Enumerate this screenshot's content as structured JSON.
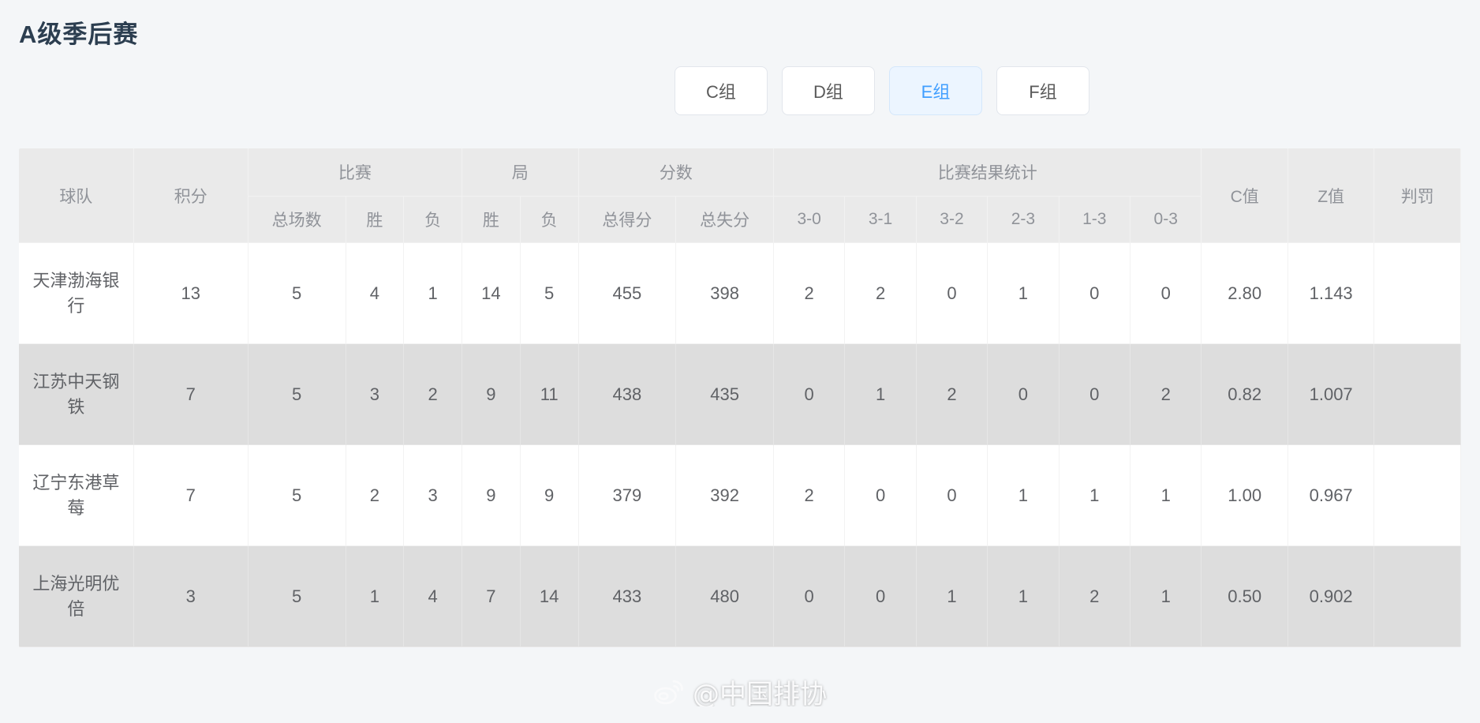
{
  "page": {
    "title": "A级季后赛"
  },
  "tabs": [
    {
      "label": "C组",
      "active": false
    },
    {
      "label": "D组",
      "active": false
    },
    {
      "label": "E组",
      "active": true
    },
    {
      "label": "F组",
      "active": false
    }
  ],
  "table": {
    "group_headers": [
      {
        "label": "球队",
        "rowspan": 2,
        "colspan": 1
      },
      {
        "label": "积分",
        "rowspan": 2,
        "colspan": 1
      },
      {
        "label": "比赛",
        "rowspan": 1,
        "colspan": 3
      },
      {
        "label": "局",
        "rowspan": 1,
        "colspan": 2
      },
      {
        "label": "分数",
        "rowspan": 1,
        "colspan": 2
      },
      {
        "label": "比赛结果统计",
        "rowspan": 1,
        "colspan": 6
      },
      {
        "label": "C值",
        "rowspan": 2,
        "colspan": 1
      },
      {
        "label": "Z值",
        "rowspan": 2,
        "colspan": 1
      },
      {
        "label": "判罚",
        "rowspan": 2,
        "colspan": 1
      }
    ],
    "sub_headers": [
      "总场数",
      "胜",
      "负",
      "胜",
      "负",
      "总得分",
      "总失分",
      "3-0",
      "3-1",
      "3-2",
      "2-3",
      "1-3",
      "0-3"
    ],
    "rows": [
      {
        "team": "天津渤海银行",
        "points": "13",
        "matches_total": "5",
        "matches_win": "4",
        "matches_loss": "1",
        "sets_win": "14",
        "sets_loss": "5",
        "points_for": "455",
        "points_against": "398",
        "r30": "2",
        "r31": "2",
        "r32": "0",
        "r23": "1",
        "r13": "0",
        "r03": "0",
        "c_value": "2.80",
        "z_value": "1.143",
        "penalty": ""
      },
      {
        "team": "江苏中天钢铁",
        "points": "7",
        "matches_total": "5",
        "matches_win": "3",
        "matches_loss": "2",
        "sets_win": "9",
        "sets_loss": "11",
        "points_for": "438",
        "points_against": "435",
        "r30": "0",
        "r31": "1",
        "r32": "2",
        "r23": "0",
        "r13": "0",
        "r03": "2",
        "c_value": "0.82",
        "z_value": "1.007",
        "penalty": ""
      },
      {
        "team": "辽宁东港草莓",
        "points": "7",
        "matches_total": "5",
        "matches_win": "2",
        "matches_loss": "3",
        "sets_win": "9",
        "sets_loss": "9",
        "points_for": "379",
        "points_against": "392",
        "r30": "2",
        "r31": "0",
        "r32": "0",
        "r23": "1",
        "r13": "1",
        "r03": "1",
        "c_value": "1.00",
        "z_value": "0.967",
        "penalty": ""
      },
      {
        "team": "上海光明优倍",
        "points": "3",
        "matches_total": "5",
        "matches_win": "1",
        "matches_loss": "4",
        "sets_win": "7",
        "sets_loss": "14",
        "points_for": "433",
        "points_against": "480",
        "r30": "0",
        "r31": "0",
        "r32": "1",
        "r23": "1",
        "r13": "2",
        "r03": "1",
        "c_value": "0.50",
        "z_value": "0.902",
        "penalty": ""
      }
    ]
  },
  "watermark": {
    "text": "@中国排协",
    "icon": "weibo-logo"
  },
  "colors": {
    "accent": "#409eff",
    "accent_bg": "#ecf5ff",
    "header_bg": "#eaeaea",
    "row_alt_bg": "#dddddd",
    "page_bg": "#f4f6f8",
    "title": "#2c3e50"
  }
}
